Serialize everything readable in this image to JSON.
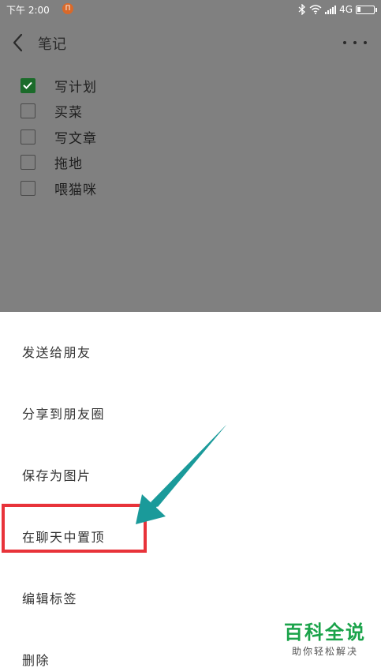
{
  "status_bar": {
    "time": "下午 2:00",
    "notification_badge": "П",
    "network": "4G",
    "battery_level": 0.2
  },
  "nav": {
    "title": "笔记"
  },
  "todos": [
    {
      "text": "写计划",
      "checked": true
    },
    {
      "text": "买菜",
      "checked": false
    },
    {
      "text": "写文章",
      "checked": false
    },
    {
      "text": "拖地",
      "checked": false
    },
    {
      "text": "喂猫咪",
      "checked": false
    }
  ],
  "action_sheet": {
    "items": [
      {
        "label": "发送给朋友"
      },
      {
        "label": "分享到朋友圈"
      },
      {
        "label": "保存为图片"
      },
      {
        "label": "在聊天中置顶"
      },
      {
        "label": "编辑标签"
      },
      {
        "label": "删除"
      }
    ]
  },
  "watermark": {
    "title": "百科全说",
    "subtitle": "助你轻松解决"
  },
  "colors": {
    "dim_overlay": "#808080",
    "checkbox_checked": "#1b6b2a",
    "highlight": "#e8333a",
    "arrow": "#1a9a9a",
    "watermark_green": "#1aa34a"
  }
}
